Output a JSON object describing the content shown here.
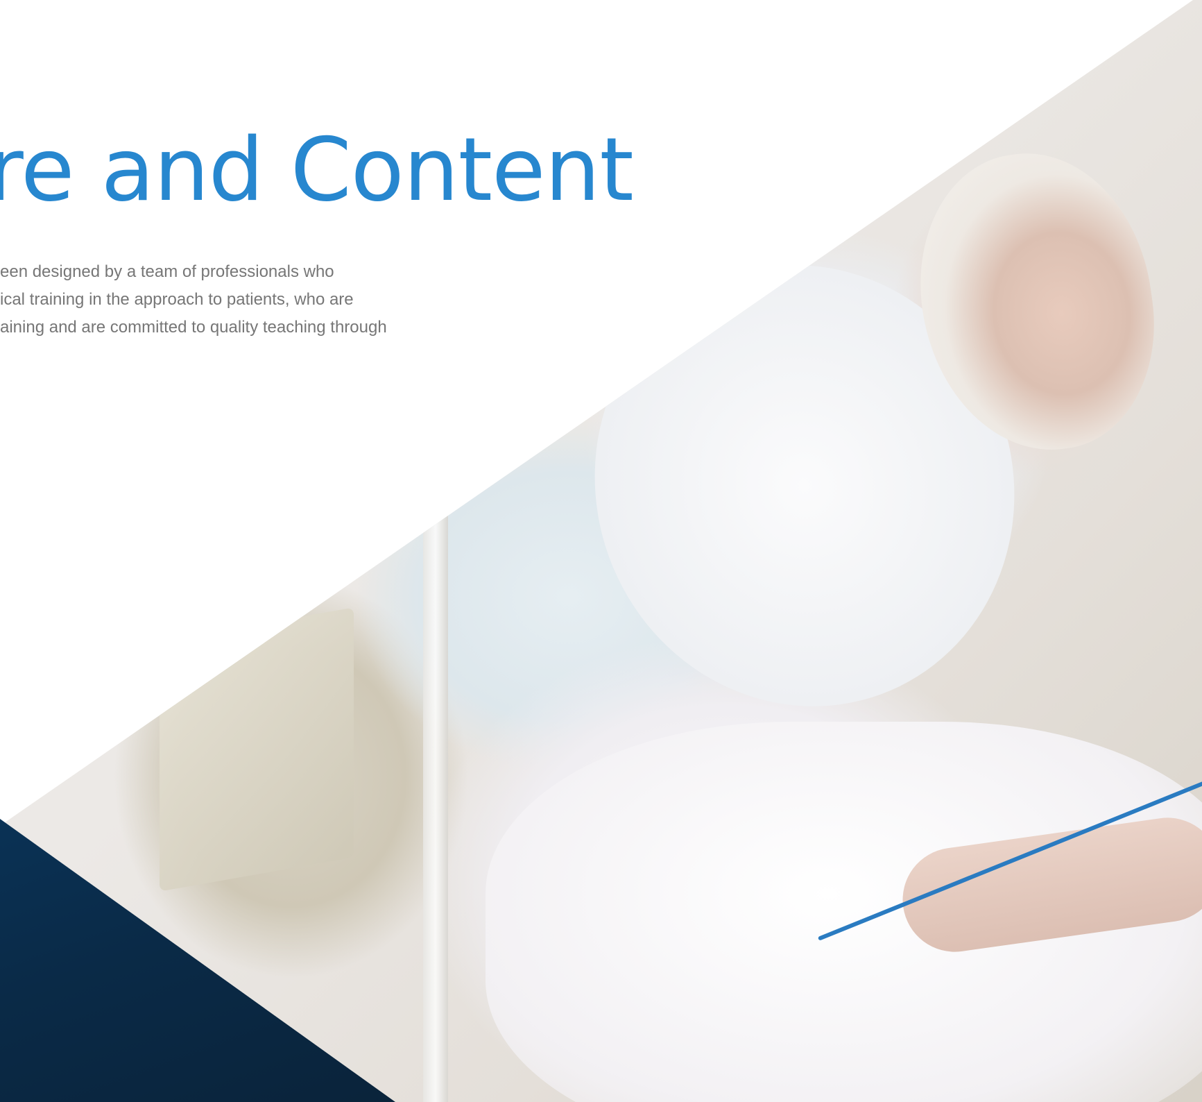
{
  "hero": {
    "title": "re and Content",
    "description_lines": [
      "een designed by a team of professionals who",
      "ical training in the approach to patients, who are",
      "aining and are committed to quality teaching through"
    ]
  },
  "colors": {
    "accent": "#2787cf",
    "body_text": "#767676",
    "corner_dark_blue": "#0a2a47",
    "iv_line_blue": "#2a7bc1"
  },
  "image": {
    "subject": "elderly patient in hospital bed wearing oxygen mask"
  }
}
